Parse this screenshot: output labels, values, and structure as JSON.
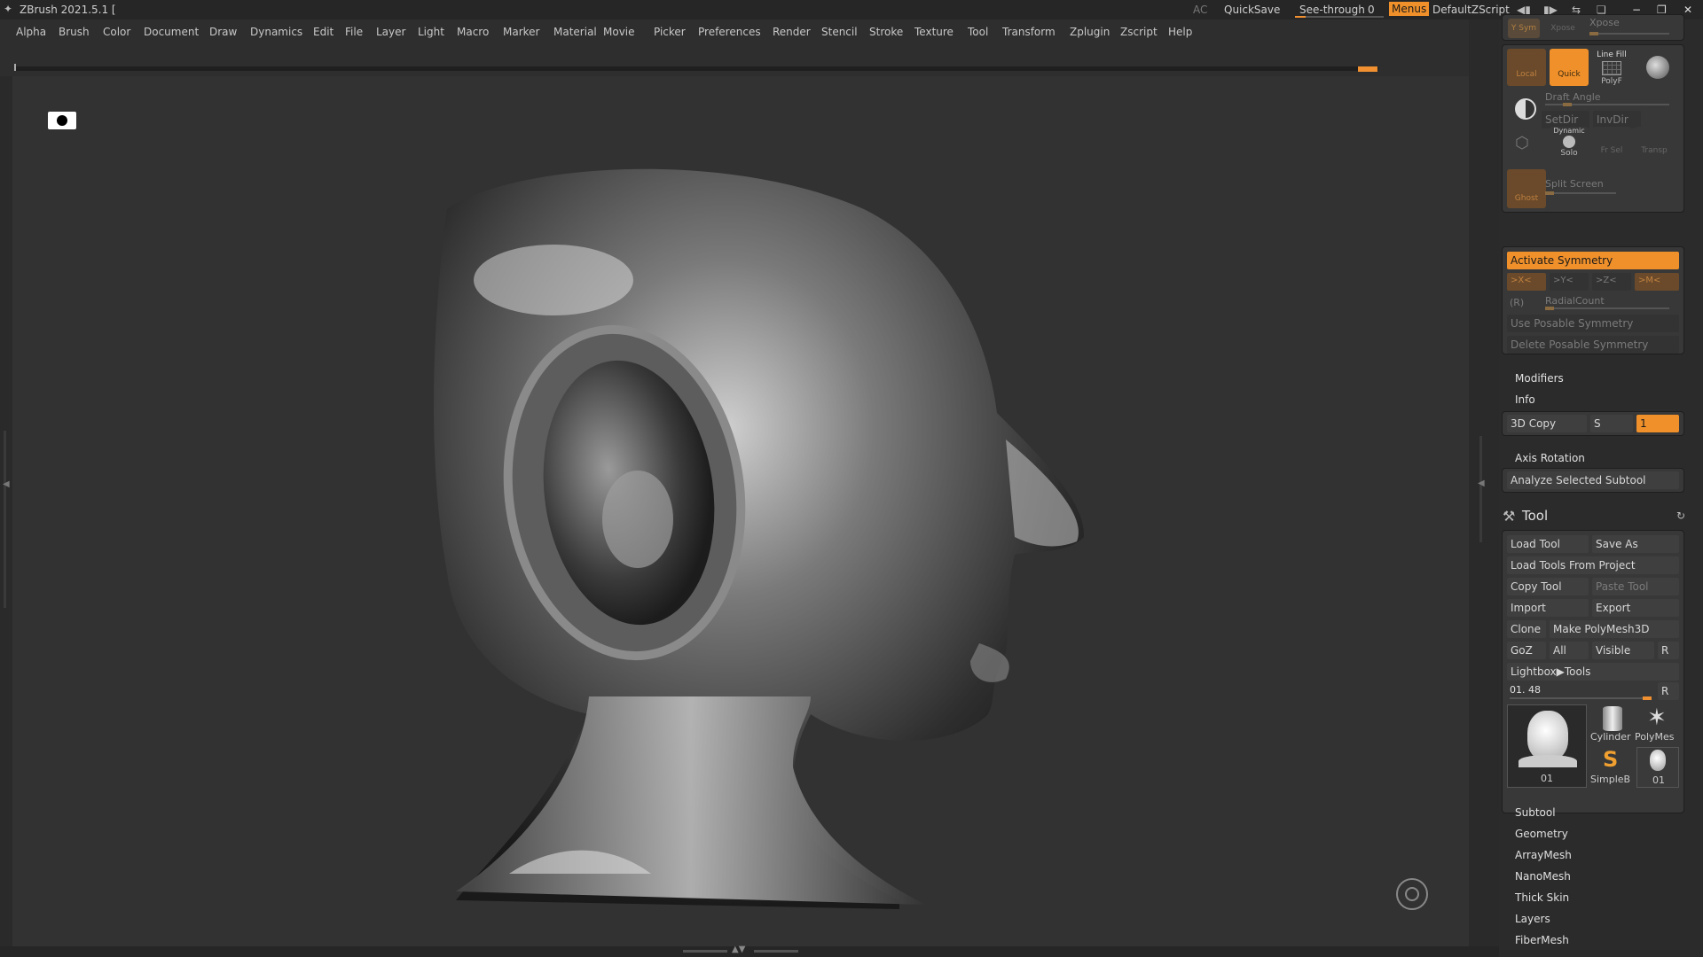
{
  "titlebar": {
    "app_title": "ZBrush 2021.5.1 [",
    "ac": "AC",
    "quicksave": "QuickSave",
    "seethrough_label": "See-through",
    "seethrough_value": "0",
    "menus": "Menus",
    "zscript": "DefaultZScript"
  },
  "menu": [
    "Alpha",
    "Brush",
    "Color",
    "Document",
    "Draw",
    "Dynamics",
    "Edit",
    "File",
    "Layer",
    "Light",
    "Macro",
    "Marker",
    "Material",
    "Movie",
    "Picker",
    "Preferences",
    "Render",
    "Stencil",
    "Stroke",
    "Texture",
    "Tool",
    "Transform",
    "Zplugin",
    "Zscript",
    "Help"
  ],
  "transform": {
    "ysym": "Y Sym",
    "xpose": "Xpose",
    "local": "Local",
    "quick": "Quick",
    "linefill": "Line Fill",
    "polyf": "PolyF",
    "draft_angle": "Draft Angle",
    "setdir": "SetDir",
    "invdir": "InvDir",
    "dynamic": "Dynamic",
    "solo": "Solo",
    "frsel": "Fr Sel",
    "transp": "Transp",
    "ghost": "Ghost",
    "split_screen": "Split Screen"
  },
  "symmetry": {
    "activate": "Activate Symmetry",
    "x": ">X<",
    "y": ">Y<",
    "z": ">Z<",
    "m": ">M<",
    "r": "(R)",
    "radial": "RadialCount",
    "use_posable": "Use Posable Symmetry",
    "delete_posable": "Delete Posable Symmetry"
  },
  "sections_top": [
    "Modifiers",
    "Info"
  ],
  "copy3d": {
    "label": "3D Copy",
    "s": "S",
    "value": "1"
  },
  "axis_rotation": "Axis Rotation",
  "analyze": "Analyze Selected Subtool",
  "tool": {
    "title": "Tool",
    "load": "Load Tool",
    "save_as": "Save As",
    "load_project": "Load Tools From Project",
    "copy": "Copy Tool",
    "paste": "Paste Tool",
    "import": "Import",
    "export": "Export",
    "clone": "Clone",
    "make_polymesh": "Make PolyMesh3D",
    "goz": "GoZ",
    "all": "All",
    "visible": "Visible",
    "r": "R",
    "lightbox": "Lightbox▶Tools",
    "current": "01. 48",
    "thumbs": [
      "01",
      "Cylinder",
      "PolyMes",
      "SimpleB",
      "01"
    ]
  },
  "sections_bottom": [
    "Subtool",
    "Geometry",
    "ArrayMesh",
    "NanoMesh",
    "Thick Skin",
    "Layers",
    "FiberMesh"
  ]
}
